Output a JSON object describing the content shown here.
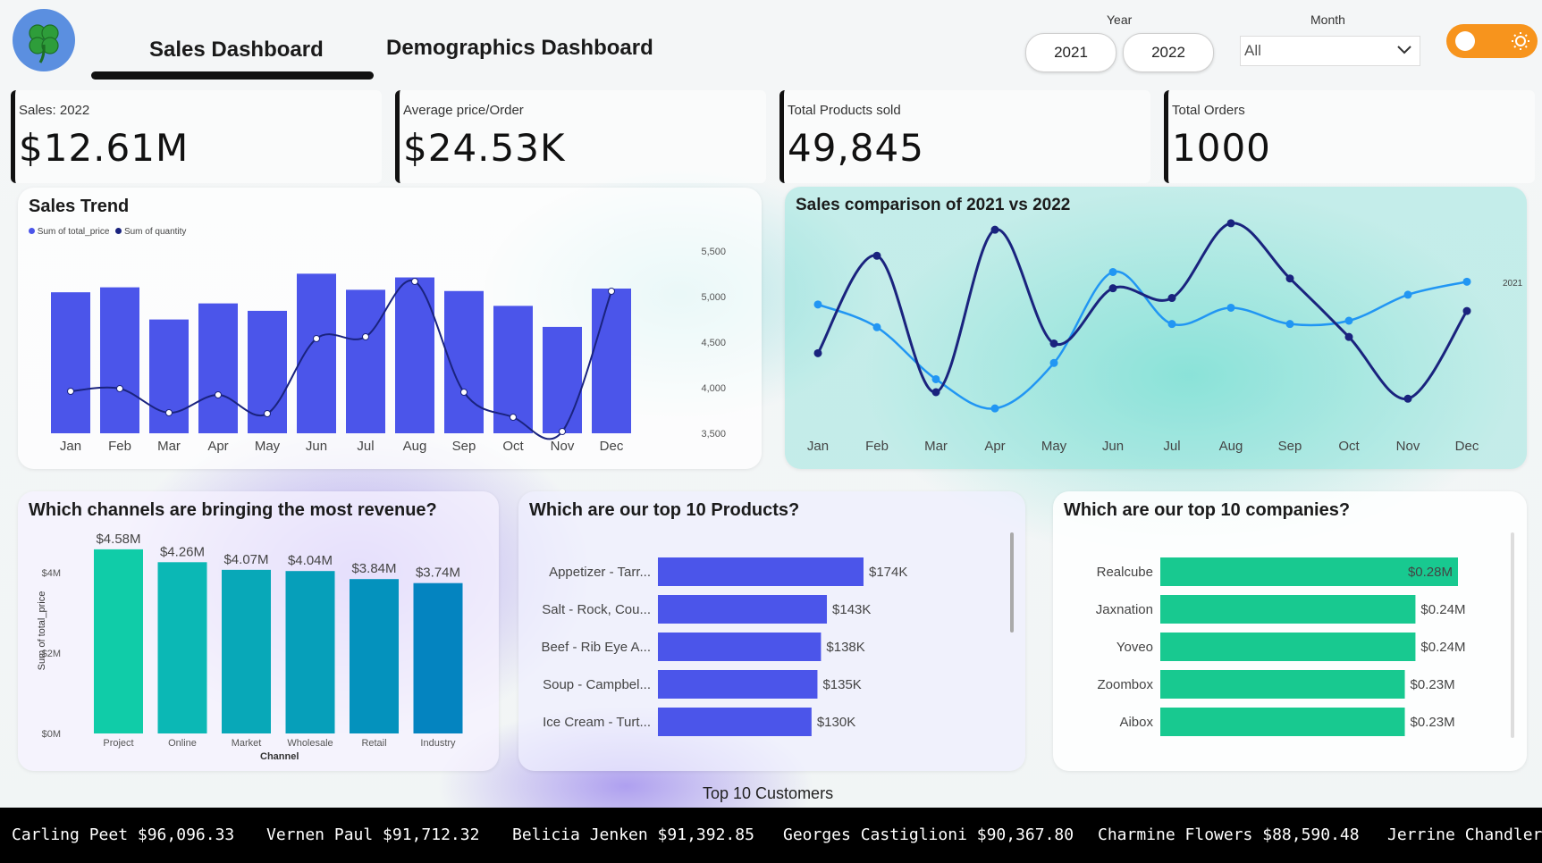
{
  "nav": {
    "tabs": [
      {
        "label": "Sales Dashboard",
        "active": true
      },
      {
        "label": "Demographics Dashboard",
        "active": false
      }
    ],
    "logo_icon": "four-leaf-clover-icon"
  },
  "filters": {
    "year_label": "Year",
    "years": [
      "2021",
      "2022"
    ],
    "month_label": "Month",
    "month_value": "All",
    "theme_toggle_icon": "sun-icon"
  },
  "kpis": [
    {
      "label": "Sales: 2022",
      "value": "$12.61M"
    },
    {
      "label": "Average price/Order",
      "value": "$24.53K"
    },
    {
      "label": "Total Products sold",
      "value": "49,845"
    },
    {
      "label": "Total Orders",
      "value": "1000"
    }
  ],
  "colors": {
    "bar_blue": "#4b55ea",
    "line_dark": "#1a237e",
    "line_light": "#2196f3",
    "teal": "#18c990",
    "accent_orange": "#f7941d"
  },
  "sales_trend": {
    "title": "Sales Trend",
    "legend": [
      "Sum of total_price",
      "Sum of quantity"
    ],
    "chart_data": {
      "type": "bar",
      "categories": [
        "Jan",
        "Feb",
        "Mar",
        "Apr",
        "May",
        "Jun",
        "Jul",
        "Aug",
        "Sep",
        "Oct",
        "Nov",
        "Dec"
      ],
      "series": [
        {
          "name": "Sum of total_price",
          "values": [
            1.14,
            1.18,
            0.92,
            1.05,
            0.99,
            1.29,
            1.16,
            1.26,
            1.15,
            1.03,
            0.86,
            1.17
          ]
        },
        {
          "name": "Sum of quantity",
          "values": [
            3970,
            4000,
            3730,
            3930,
            3720,
            4560,
            4580,
            5200,
            3960,
            3680,
            3520,
            5090
          ]
        }
      ],
      "right_axis_ticks": [
        "5,500",
        "5,000",
        "4,500",
        "4,000",
        "3,500"
      ],
      "right_ylim": [
        3500,
        5500
      ]
    }
  },
  "sales_comparison": {
    "title": "Sales comparison of 2021 vs 2022",
    "series_label": "2021",
    "chart_data": {
      "type": "line",
      "categories": [
        "Jan",
        "Feb",
        "Mar",
        "Apr",
        "May",
        "Jun",
        "Jul",
        "Aug",
        "Sep",
        "Oct",
        "Nov",
        "Dec"
      ],
      "series": [
        {
          "name": "2021",
          "values": [
            0.98,
            0.91,
            0.75,
            0.66,
            0.8,
            1.08,
            0.92,
            0.97,
            0.92,
            0.93,
            1.01,
            1.05
          ]
        },
        {
          "name": "",
          "values": [
            0.83,
            1.13,
            0.71,
            1.21,
            0.86,
            1.03,
            1.0,
            1.23,
            1.06,
            0.88,
            0.69,
            0.96
          ]
        }
      ]
    }
  },
  "channels": {
    "title": "Which channels are bringing the most revenue?",
    "chart_data": {
      "type": "bar",
      "categories": [
        "Project",
        "Online",
        "Market",
        "Wholesale",
        "Retail",
        "Industry"
      ],
      "values": [
        4.58,
        4.26,
        4.07,
        4.04,
        3.84,
        3.74
      ],
      "data_labels": [
        "$4.58M",
        "$4.26M",
        "$4.07M",
        "$4.04M",
        "$3.84M",
        "$3.74M"
      ],
      "xlabel": "Channel",
      "ylabel": "Sum of total_price",
      "yticks": [
        "$4M",
        "$2M",
        "$0M"
      ],
      "ylim": [
        0,
        4.8
      ]
    }
  },
  "top_products": {
    "title": "Which are our top 10 Products?",
    "chart_data": {
      "type": "bar",
      "categories": [
        "Appetizer - Tarr...",
        "Salt - Rock, Cou...",
        "Beef - Rib Eye A...",
        "Soup - Campbel...",
        "Ice Cream - Turt..."
      ],
      "values": [
        174,
        143,
        138,
        135,
        130
      ],
      "data_labels": [
        "$174K",
        "$143K",
        "$138K",
        "$135K",
        "$130K"
      ]
    }
  },
  "top_companies": {
    "title": "Which are our top 10 companies?",
    "chart_data": {
      "type": "bar",
      "categories": [
        "Realcube",
        "Jaxnation",
        "Yoveo",
        "Zoombox",
        "Aibox"
      ],
      "values": [
        0.28,
        0.24,
        0.24,
        0.23,
        0.23
      ],
      "data_labels": [
        "$0.28M",
        "$0.24M",
        "$0.24M",
        "$0.23M",
        "$0.23M"
      ]
    }
  },
  "customers": {
    "title": "Top 10 Customers",
    "items": [
      "Carling Peet $96,096.33",
      "Vernen Paul $91,712.32",
      "Belicia Jenken $91,392.85",
      "Georges Castiglioni $90,367.80",
      "Charmine Flowers $88,590.48",
      "Jerrine Chandler $"
    ]
  }
}
